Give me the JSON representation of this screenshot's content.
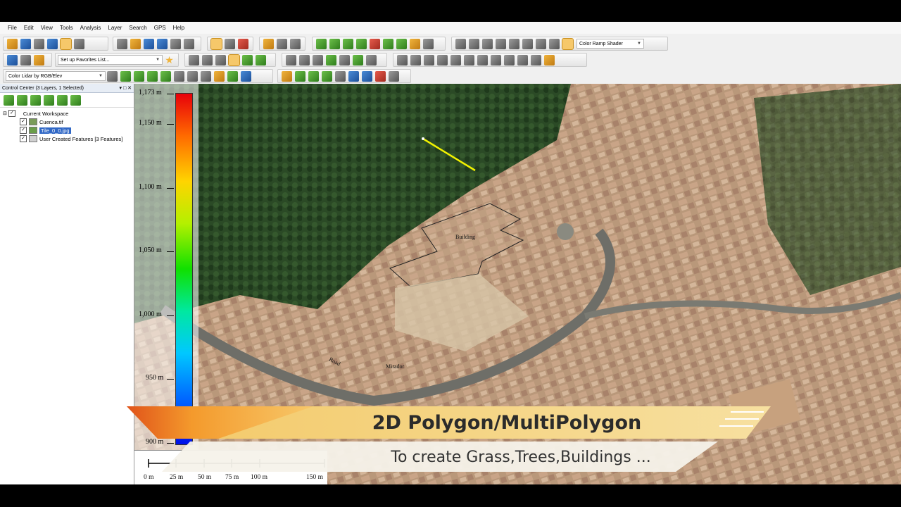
{
  "menu": [
    "File",
    "Edit",
    "View",
    "Tools",
    "Analysis",
    "Layer",
    "Search",
    "GPS",
    "Help"
  ],
  "toolbar": {
    "favorites_placeholder": "Set up Favorites List...",
    "shader_select": "Color Ramp Shader",
    "lidar_select": "Color Lidar by RGB/Elev"
  },
  "control_center": {
    "title": "Control Center (3 Layers, 1 Selected)",
    "workspace": "Current Workspace",
    "layers": [
      "Cuenca.tif",
      "Tile_0_0.jpg",
      "User Created Features [3 Features]"
    ],
    "selected_layer_index": 1
  },
  "legend": {
    "ticks": [
      "1,173 m",
      "1,150 m",
      "1,100 m",
      "1,050 m",
      "1,000 m",
      "950 m",
      "900 m"
    ],
    "scale_labels": [
      "0 m",
      "25 m",
      "50 m",
      "75 m",
      "100 m",
      "150 m"
    ]
  },
  "map_labels": {
    "building": "Building",
    "road": "Road",
    "mirador": "Mirador"
  },
  "banner": {
    "title": "2D Polygon/MultiPolygon",
    "subtitle": "To create Grass,Trees,Buildings ..."
  },
  "colors": {
    "accent_orange": "#f07a20",
    "selection_blue": "#3168c6",
    "line_feature": "#f2f200"
  }
}
